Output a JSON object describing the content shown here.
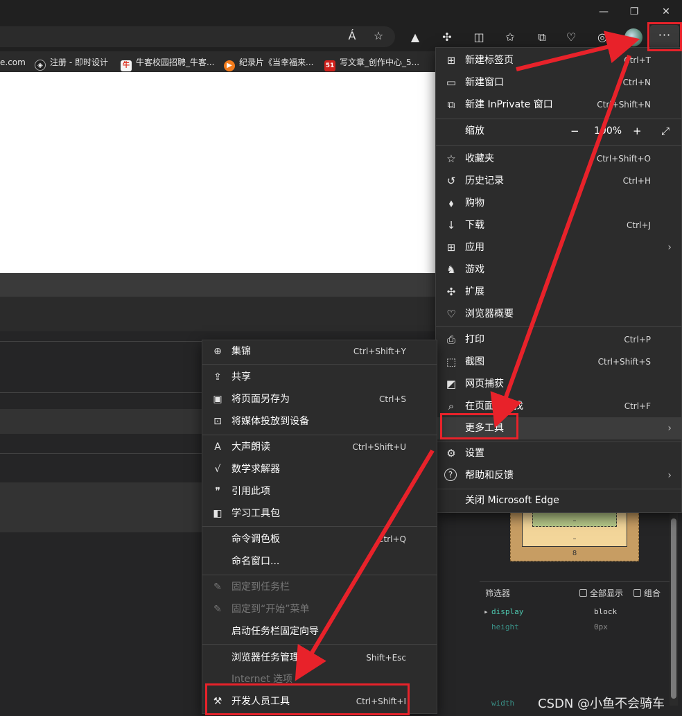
{
  "window": {
    "minimize": "—",
    "restore": "❐",
    "close": "✕"
  },
  "toolbar": {
    "more_label": "···",
    "read_aloud_icon": "Á",
    "favorite_icon": "☆"
  },
  "bookmarks": [
    {
      "label": "e.com",
      "icon_text": "",
      "color": "#202020"
    },
    {
      "label": "注册 - 即时设计",
      "icon_text": "◈",
      "color": "#202020"
    },
    {
      "label": "牛客校园招聘_牛客...",
      "icon_text": "牛",
      "color": "#f5f5f5"
    },
    {
      "label": "纪录片《当幸福来...",
      "icon_text": "▶",
      "color": "#f27b1b"
    },
    {
      "label": "写文章_创作中心_5...",
      "icon_text": "51",
      "color": "#d0211c"
    }
  ],
  "menu": {
    "items": [
      {
        "icon": "new-tab-icon",
        "glyph": "⊞",
        "label": "新建标签页",
        "shortcut": "Ctrl+T"
      },
      {
        "icon": "new-window-icon",
        "glyph": "▭",
        "label": "新建窗口",
        "shortcut": "Ctrl+N"
      },
      {
        "icon": "inprivate-icon",
        "glyph": "⧉",
        "label": "新建 InPrivate 窗口",
        "shortcut": "Ctrl+Shift+N"
      }
    ],
    "zoom": {
      "label": "缩放",
      "minus": "−",
      "value": "100%",
      "plus": "+",
      "fullscreen": "⤢"
    },
    "items2": [
      {
        "icon": "favorites-icon",
        "glyph": "☆",
        "label": "收藏夹",
        "shortcut": "Ctrl+Shift+O"
      },
      {
        "icon": "history-icon",
        "glyph": "↺",
        "label": "历史记录",
        "shortcut": "Ctrl+H"
      },
      {
        "icon": "shopping-tag-icon",
        "glyph": "⬧",
        "label": "购物",
        "shortcut": ""
      },
      {
        "icon": "download-icon",
        "glyph": "↓",
        "label": "下载",
        "shortcut": "Ctrl+J"
      },
      {
        "icon": "apps-icon",
        "glyph": "⊞",
        "label": "应用",
        "shortcut": ""
      },
      {
        "icon": "games-icon",
        "glyph": "♞",
        "label": "游戏",
        "shortcut": ""
      },
      {
        "icon": "extensions-icon",
        "glyph": "✣",
        "label": "扩展",
        "shortcut": ""
      },
      {
        "icon": "browser-essentials-icon",
        "glyph": "♡",
        "label": "浏览器概要",
        "shortcut": ""
      }
    ],
    "items3": [
      {
        "icon": "print-icon",
        "glyph": "⎙",
        "label": "打印",
        "shortcut": "Ctrl+P"
      },
      {
        "icon": "screenshot-icon",
        "glyph": "⬚",
        "label": "截图",
        "shortcut": "Ctrl+Shift+S"
      },
      {
        "icon": "web-capture-icon",
        "glyph": "◩",
        "label": "网页捕获",
        "shortcut": ""
      },
      {
        "icon": "find-icon",
        "glyph": "⌕",
        "label": "在页面上查找",
        "shortcut": "Ctrl+F"
      },
      {
        "icon": "more-tools-icon",
        "glyph": "",
        "label": "更多工具",
        "shortcut": ""
      }
    ],
    "items4": [
      {
        "icon": "settings-icon",
        "glyph": "⚙",
        "label": "设置",
        "shortcut": ""
      },
      {
        "icon": "help-icon",
        "glyph": "?",
        "label": "帮助和反馈",
        "shortcut": ""
      }
    ],
    "close_label": "关闭 Microsoft Edge"
  },
  "submenu": {
    "items": [
      {
        "icon": "collections-icon",
        "glyph": "⊕",
        "label": "集锦",
        "shortcut": "Ctrl+Shift+Y"
      },
      {
        "icon": "share-icon",
        "glyph": "⇪",
        "label": "共享",
        "shortcut": ""
      },
      {
        "icon": "save-page-icon",
        "glyph": "▣",
        "label": "将页面另存为",
        "shortcut": "Ctrl+S"
      },
      {
        "icon": "cast-icon",
        "glyph": "⊡",
        "label": "将媒体投放到设备",
        "shortcut": ""
      },
      {
        "icon": "read-aloud-icon",
        "glyph": "A",
        "label": "大声朗读",
        "shortcut": "Ctrl+Shift+U"
      },
      {
        "icon": "math-solver-icon",
        "glyph": "√",
        "label": "数学求解器",
        "shortcut": ""
      },
      {
        "icon": "cite-icon",
        "glyph": "❞",
        "label": "引用此项",
        "shortcut": ""
      },
      {
        "icon": "learning-toolkit-icon",
        "glyph": "◧",
        "label": "学习工具包",
        "shortcut": ""
      },
      {
        "icon": "",
        "glyph": "",
        "label": "命令调色板",
        "shortcut": "Ctrl+Q"
      },
      {
        "icon": "",
        "glyph": "",
        "label": "命名窗口...",
        "shortcut": ""
      },
      {
        "icon": "pin-icon",
        "glyph": "✎",
        "label": "固定到任务栏",
        "shortcut": ""
      },
      {
        "icon": "pin-start-icon",
        "glyph": "✎",
        "label": "固定到“开始”菜单",
        "shortcut": ""
      },
      {
        "icon": "",
        "glyph": "",
        "label": "启动任务栏固定向导",
        "shortcut": ""
      },
      {
        "icon": "",
        "glyph": "",
        "label": "浏览器任务管理器",
        "shortcut": "Shift+Esc"
      },
      {
        "icon": "",
        "glyph": "",
        "label": "Internet 选项",
        "shortcut": ""
      },
      {
        "icon": "devtools-icon",
        "glyph": "⚒",
        "label": "开发人员工具",
        "shortcut": "Ctrl+Shift+I"
      }
    ]
  },
  "devtools": {
    "box_dash1": "–",
    "box_dash2": "–",
    "box_margin": "8",
    "filter_label": "筛选器",
    "show_all": "全部显示",
    "group": "组合",
    "props": [
      {
        "name": "display",
        "value": "block"
      },
      {
        "name": "height",
        "value": "0px"
      },
      {
        "name": "width",
        "value": ""
      }
    ]
  },
  "watermark": "CSDN @小鱼不会骑车",
  "colors": {
    "highlight_red": "#e8222a",
    "menu_bg": "#2c2c2c",
    "prop_name": "#4ec9b0"
  }
}
